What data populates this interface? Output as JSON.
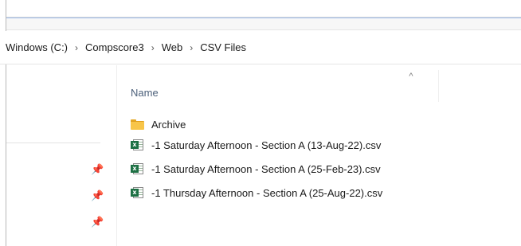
{
  "breadcrumb": [
    {
      "label": "Windows (C:)"
    },
    {
      "label": "Compscore3"
    },
    {
      "label": "Web"
    },
    {
      "label": "CSV Files"
    }
  ],
  "breadcrumb_separator": "›",
  "column_header": {
    "name_label": "Name",
    "sort_glyph": "^"
  },
  "pins": [
    "pin-icon",
    "pin-icon",
    "pin-icon"
  ],
  "items": [
    {
      "type": "folder",
      "icon": "folder-icon",
      "name": "Archive"
    },
    {
      "type": "csv",
      "icon": "excel-csv-icon",
      "name": "-1 Saturday Afternoon - Section A (13-Aug-22).csv"
    },
    {
      "type": "csv",
      "icon": "excel-csv-icon",
      "name": "-1 Saturday Afternoon - Section A (25-Feb-23).csv"
    },
    {
      "type": "csv",
      "icon": "excel-csv-icon",
      "name": "-1 Thursday Afternoon - Section A (25-Aug-22).csv"
    }
  ],
  "colors": {
    "accent": "#3b78d8",
    "folder": "#f8c548",
    "excel": "#1d7044",
    "header_text": "#4c607a"
  }
}
